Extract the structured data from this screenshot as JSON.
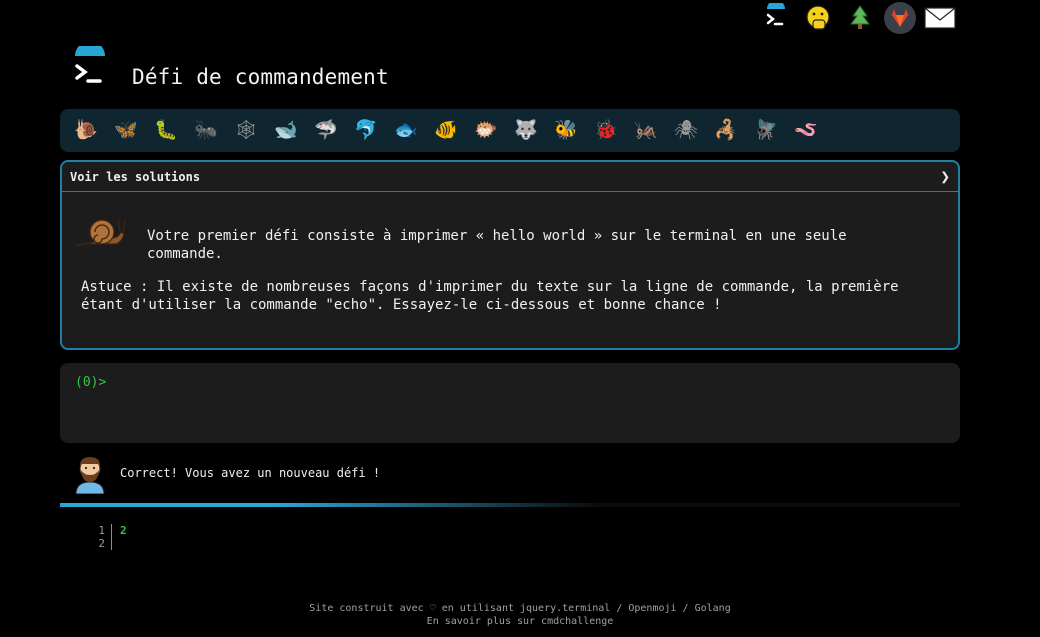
{
  "top_icons": [
    {
      "name": "terminal-icon",
      "glyph": ">_"
    },
    {
      "name": "hand-over-mouth-icon",
      "glyph": "🤭"
    },
    {
      "name": "tree-icon",
      "glyph": "🌲"
    },
    {
      "name": "gitlab-icon",
      "glyph": "🦊"
    },
    {
      "name": "mail-icon",
      "glyph": "✉"
    }
  ],
  "header": {
    "title": "Défi de commandement"
  },
  "challenge_strip": [
    {
      "name": "snail-icon",
      "glyph": "🐌"
    },
    {
      "name": "butterfly-icon",
      "glyph": "🦋"
    },
    {
      "name": "caterpillar-icon",
      "glyph": "🐛"
    },
    {
      "name": "ant-icon",
      "glyph": "🐜"
    },
    {
      "name": "spider-web-icon",
      "glyph": "🕸"
    },
    {
      "name": "whale-icon",
      "glyph": "🐋"
    },
    {
      "name": "shark-icon",
      "glyph": "🦈"
    },
    {
      "name": "dolphin-icon",
      "glyph": "🐬"
    },
    {
      "name": "fish-icon",
      "glyph": "🐟"
    },
    {
      "name": "tropical-fish-icon",
      "glyph": "🐠"
    },
    {
      "name": "blowfish-icon",
      "glyph": "🐡"
    },
    {
      "name": "wolf-icon",
      "glyph": "🐺"
    },
    {
      "name": "bee-icon",
      "glyph": "🐝"
    },
    {
      "name": "ladybug-icon",
      "glyph": "🐞"
    },
    {
      "name": "cricket-icon",
      "glyph": "🦗"
    },
    {
      "name": "spider-icon",
      "glyph": "🕷"
    },
    {
      "name": "scorpion-icon",
      "glyph": "🦂"
    },
    {
      "name": "fly-icon",
      "glyph": "🪰"
    },
    {
      "name": "worm-icon",
      "glyph": "🪱"
    }
  ],
  "panel": {
    "header_label": "Voir les solutions",
    "chevron": "❯",
    "description": "Votre premier défi consiste à imprimer « hello world » sur le terminal en une seule commande.",
    "hint": "Astuce : Il existe de nombreuses façons d'imprimer du texte sur la ligne de commande, la première étant d'utiliser la commande \"echo\". Essayez-le ci-dessous et bonne chance !"
  },
  "terminal": {
    "prompt_open": "(",
    "prompt_num": "0",
    "prompt_close": ")>"
  },
  "message": {
    "text": "Correct! Vous avez un nouveau défi !"
  },
  "progress": {
    "fraction": 0.6
  },
  "editor": {
    "line_numbers": [
      "1",
      "2"
    ],
    "code": "2"
  },
  "footer": {
    "line1": "Site construit avec ♡ en utilisant jquery.terminal / Openmoji / Golang",
    "line2": "En savoir plus sur cmdchallenge"
  },
  "colors": {
    "accent": "#1f7fa8",
    "prompt": "#2ecc40",
    "strip_bg": "#0f2630"
  }
}
